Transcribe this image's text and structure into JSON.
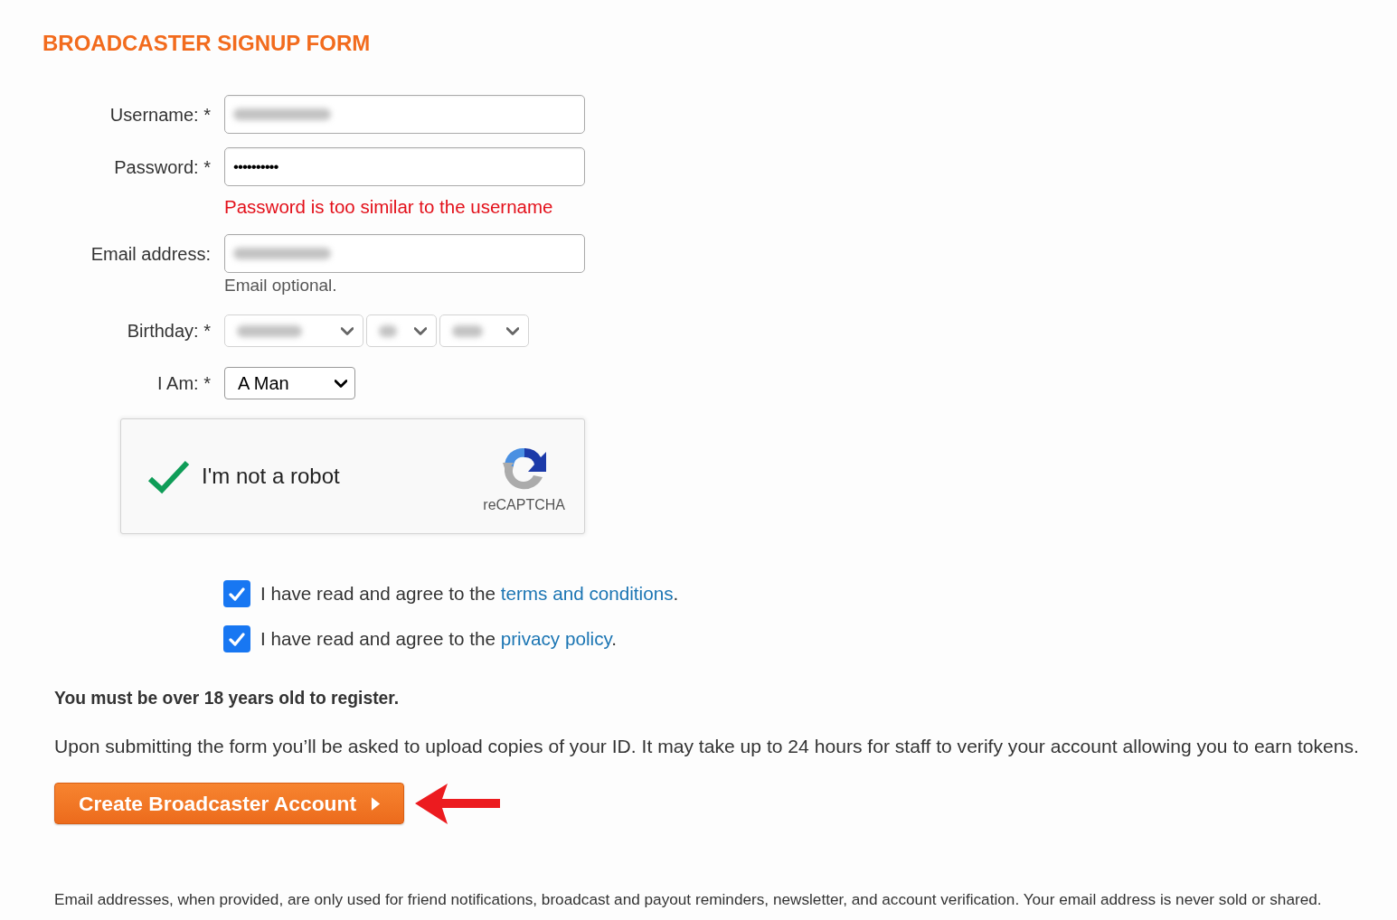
{
  "title": "BROADCASTER SIGNUP FORM",
  "fields": [
    {
      "kind": "text",
      "label": "Username: *",
      "blurred": true
    },
    {
      "kind": "password",
      "label": "Password: *",
      "value": "••••••••••",
      "error": "Password is too similar to the username"
    },
    {
      "kind": "text",
      "label": "Email address:",
      "blurred": true,
      "hint": "Email optional."
    },
    {
      "kind": "selects",
      "label": "Birthday: *",
      "selects": [
        {
          "blurred": true
        },
        {
          "blurred": true
        },
        {
          "blurred": true
        }
      ]
    },
    {
      "kind": "select",
      "label": "I Am: *",
      "value": "A Man"
    }
  ],
  "captcha": {
    "checked": true,
    "label": "I'm not a robot",
    "brand": "reCAPTCHA"
  },
  "agreements": [
    {
      "checked": true,
      "text": "I have read and agree to the",
      "link": "terms and conditions",
      "after": "."
    },
    {
      "checked": true,
      "text": "I have read and agree to the",
      "link": "privacy policy",
      "after": "."
    }
  ],
  "age_notice": "You must be over 18 years old to register.",
  "info": "Upon submitting the form you’ll be asked to upload copies of your ID. It may take up to 24 hours for staff to verify your account allowing you to earn tokens.",
  "submit": {
    "label": "Create Broadcaster Account"
  },
  "footer": "Email addresses, when provided, are only used for friend notifications, broadcast and payout reminders, newsletter, and account verification. Your email address is never sold or shared."
}
